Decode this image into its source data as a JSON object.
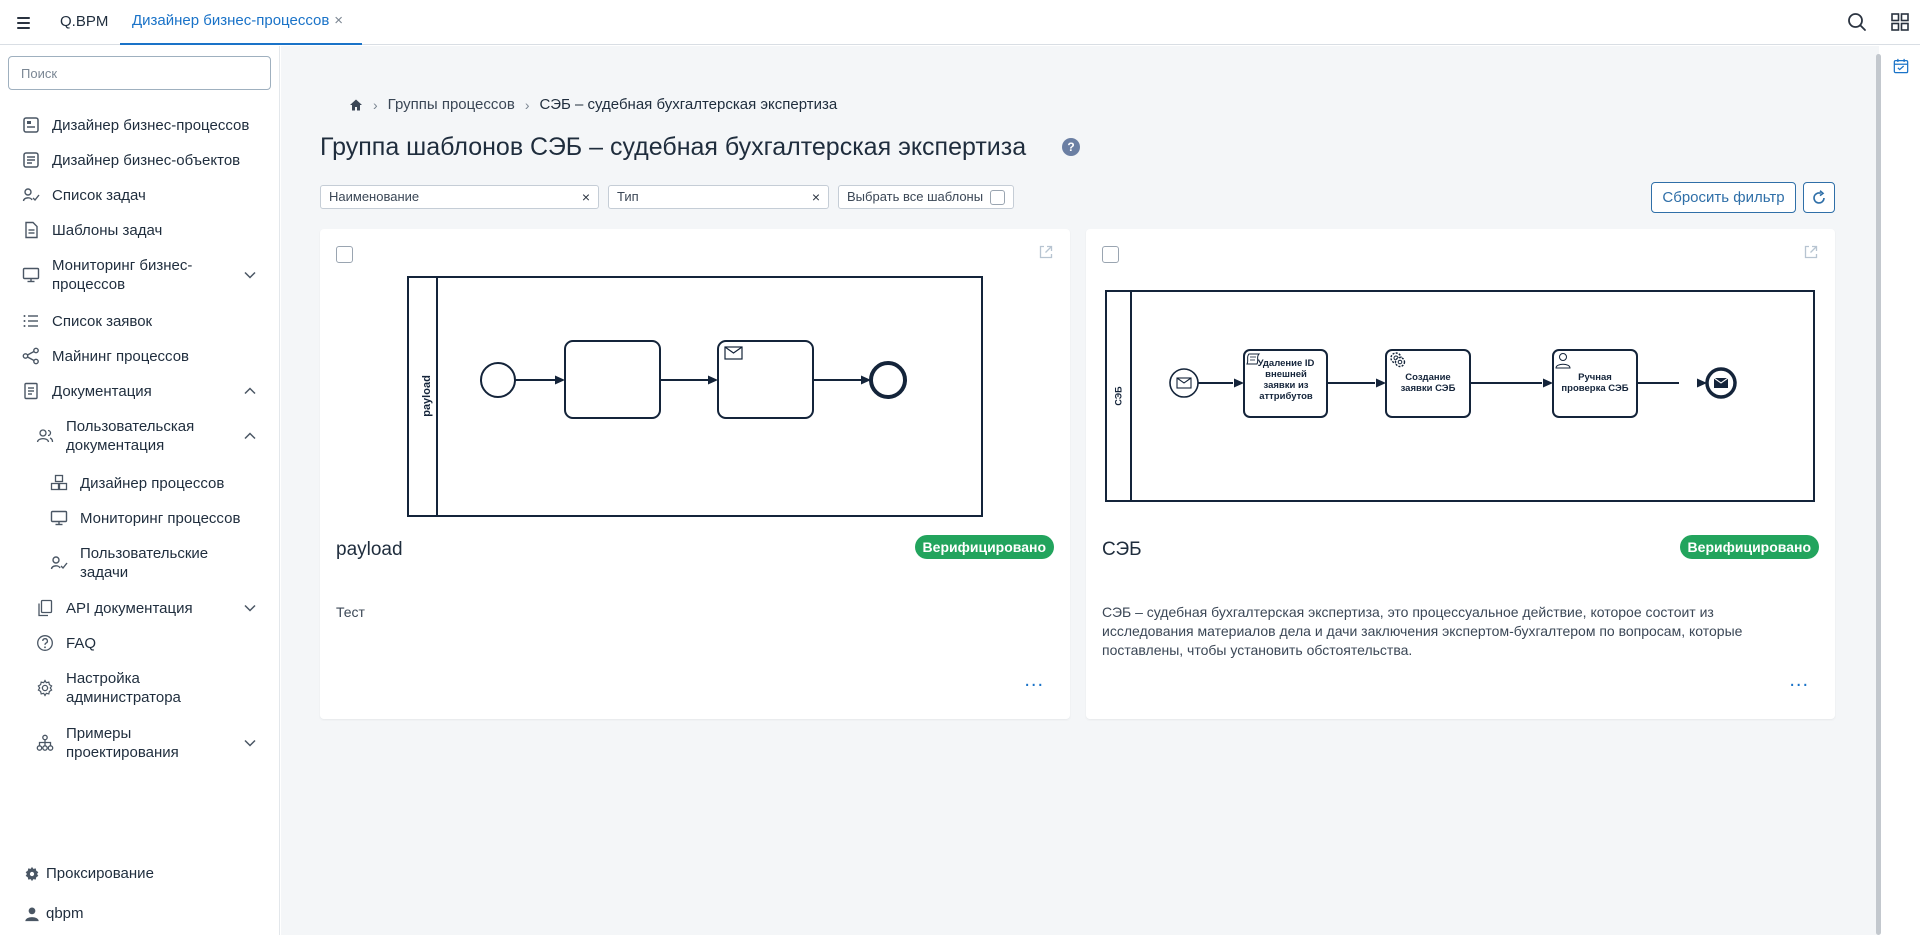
{
  "topbar": {
    "brand": "Q.BPM",
    "active_tab": "Дизайнер бизнес-процессов",
    "tab_close": "×"
  },
  "sidebar": {
    "search_placeholder": "Поиск",
    "items": [
      {
        "label": "Дизайнер бизнес-процессов",
        "icon": "process-designer-icon"
      },
      {
        "label": "Дизайнер бизнес-объектов",
        "icon": "object-designer-icon"
      },
      {
        "label": "Список задач",
        "icon": "task-list-icon"
      },
      {
        "label": "Шаблоны задач",
        "icon": "task-template-icon"
      },
      {
        "label": "Мониторинг бизнес-процессов",
        "icon": "monitor-icon"
      },
      {
        "label": "Список заявок",
        "icon": "list-icon"
      },
      {
        "label": "Майнинг процессов",
        "icon": "share-icon"
      },
      {
        "label": "Документация",
        "icon": "document-icon"
      },
      {
        "label": "Пользовательская документация",
        "icon": "users-icon"
      },
      {
        "label": "Дизайнер процессов",
        "icon": "cubes-icon"
      },
      {
        "label": "Мониторинг процессов",
        "icon": "monitor-icon"
      },
      {
        "label": "Пользовательские задачи",
        "icon": "user-task-icon"
      },
      {
        "label": "API документация",
        "icon": "copy-icon"
      },
      {
        "label": "FAQ",
        "icon": "question-icon"
      },
      {
        "label": "Настройка администратора",
        "icon": "gear-icon"
      },
      {
        "label": "Примеры проектирования",
        "icon": "hierarchy-icon"
      }
    ],
    "footer": {
      "proxy": "Проксирование",
      "user": "qbpm"
    }
  },
  "breadcrumb": {
    "home": "home-icon",
    "group": "Группы процессов",
    "current": "СЭБ – судебная бухгалтерская экспертиза",
    "separator": "›"
  },
  "page": {
    "title": "Группа шаблонов СЭБ – судебная бухгалтерская экспертиза",
    "help": "?"
  },
  "filters": {
    "name": "Наименование",
    "type": "Тип",
    "select_all": "Выбрать все шаблоны",
    "clear": "×",
    "reset": "Сбросить фильтр"
  },
  "cards": [
    {
      "name": "payload",
      "status": "Верифицировано",
      "description": "Тест",
      "lane": "payload",
      "more": "..."
    },
    {
      "name": "СЭБ",
      "status": "Верифицировано",
      "description": "СЭБ – судебная бухгалтерская экспертиза, это процессуальное действие, которое состоит из исследования материалов дела и дачи заключения экспертом-бухгалтером по вопросам, которые поставлены, чтобы установить обстоятельства.",
      "lane": "СЭБ",
      "more": "...",
      "tasks": [
        {
          "l1": "Удаление ID",
          "l2": "внешней",
          "l3": "заявки из",
          "l4": "аттрибутов"
        },
        {
          "l1": "Создание",
          "l2": "заявки СЭБ"
        },
        {
          "l1": "Ручная",
          "l2": "проверка СЭБ"
        }
      ]
    }
  ],
  "colors": {
    "accent": "#1a73c8",
    "badge": "#22a45d",
    "diagram_stroke": "#14243a"
  }
}
